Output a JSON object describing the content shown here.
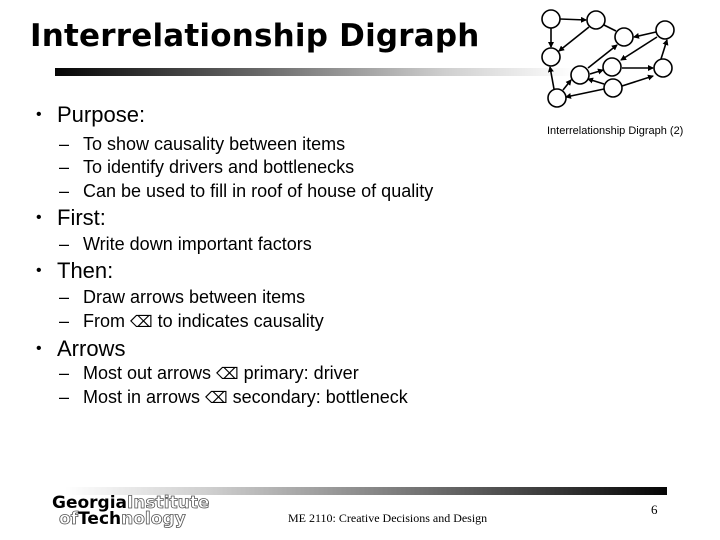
{
  "slide": {
    "title": "Interrelationship Digraph",
    "diagram_caption": "Interrelationship Digraph (2)",
    "diagram_icon": "digraph-nodes-arrows",
    "bullets": [
      {
        "label": "Purpose:",
        "sub": [
          {
            "text": "To show causality between items"
          },
          {
            "text": "To identify drivers and bottlenecks"
          },
          {
            "text": "Can be used to fill in roof of house of quality"
          }
        ]
      },
      {
        "label": "First:",
        "sub": [
          {
            "text": "Write down important factors"
          }
        ]
      },
      {
        "label": "Then:",
        "sub": [
          {
            "text": "Draw arrows between items"
          },
          {
            "before": "From ",
            "symbol": "⌫",
            "after": " to indicates causality"
          }
        ]
      },
      {
        "label": "Arrows",
        "sub": [
          {
            "before": "Most out arrows ",
            "symbol": "⌫",
            "after": " primary: driver"
          },
          {
            "before": "Most in arrows ",
            "symbol": "⌫",
            "after": " secondary: bottleneck"
          }
        ]
      }
    ],
    "bullet_char": "•",
    "dash_char": "–"
  },
  "footer": {
    "logo": {
      "line1_bold": "Georgia",
      "line1_outline": "Institute",
      "line2_outline_prefix": "of",
      "line2_bold": "Tech",
      "line2_outline": "nology"
    },
    "course": "ME 2110: Creative Decisions and Design",
    "page_number": "6"
  }
}
